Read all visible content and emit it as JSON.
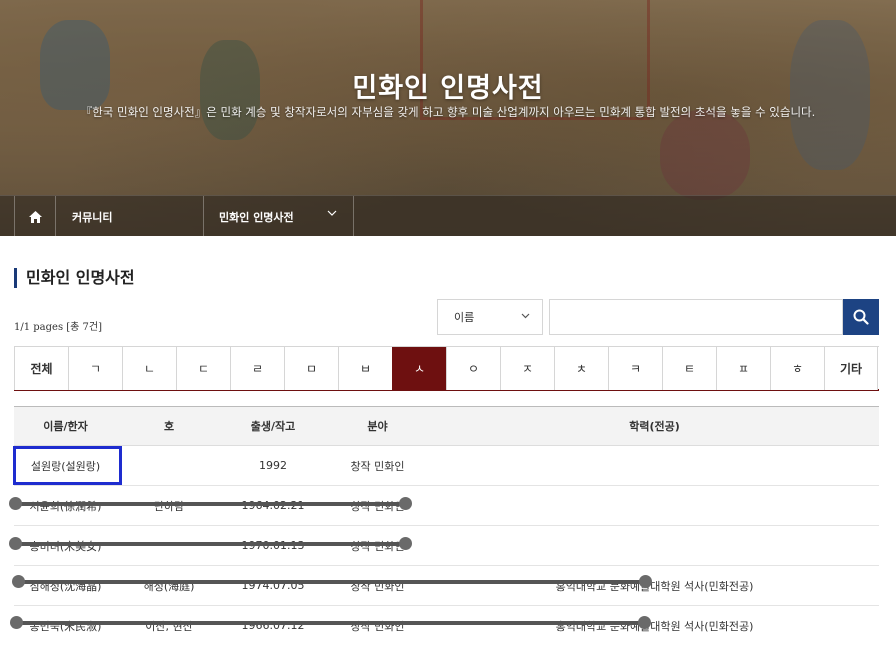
{
  "banner": {
    "title": "민화인 인명사전",
    "subtitle": "『한국 민화인 인명사전』은 민화 계승 및 창작자로서의 자부심을 갖게 하고 향후 미술 산업계까지 아우르는 민화계 통합 발전의 초석을 놓을 수 있습니다."
  },
  "nav": {
    "home_icon": "home-icon",
    "community": "커뮤니티",
    "dictionary": "민화인 인명사전"
  },
  "section_title": "민화인 인명사전",
  "pages_info": "1/1 pages [총 7건]",
  "search": {
    "field_selected": "이름",
    "placeholder": "",
    "button_icon": "search-icon"
  },
  "tabs": [
    "전체",
    "ㄱ",
    "ㄴ",
    "ㄷ",
    "ㄹ",
    "ㅁ",
    "ㅂ",
    "ㅅ",
    "ㅇ",
    "ㅈ",
    "ㅊ",
    "ㅋ",
    "ㅌ",
    "ㅍ",
    "ㅎ",
    "기타"
  ],
  "active_tab": "ㅅ",
  "colors": {
    "accent": "#6e1010",
    "search_button": "#1d4383",
    "highlight": "#1e2ccf"
  },
  "table": {
    "headers": [
      "이름/한자",
      "호",
      "출생/작고",
      "분야",
      "학력(전공)"
    ],
    "rows": [
      [
        "설원랑(설원랑)",
        "",
        "1992",
        "창작 민화인",
        ""
      ],
      [
        "서윤희(徐潤希)",
        "단하람",
        "1964.02.21",
        "창작 민화인",
        ""
      ],
      [
        "송미녀(宋美女)",
        "",
        "1970.01.13",
        "창작 민화인",
        ""
      ],
      [
        "심해정(沈海晶)",
        "해정(海庭)",
        "1974.07.05",
        "창작 민화인",
        "홍익대학교 문화예술대학원 석사(민화전공)"
      ],
      [
        "송민숙(宋民淑)",
        "이산, 현산",
        "1966.07.12",
        "창작 민화인",
        "홍익대학교 문화예술대학원 석사(민화전공)"
      ]
    ]
  }
}
